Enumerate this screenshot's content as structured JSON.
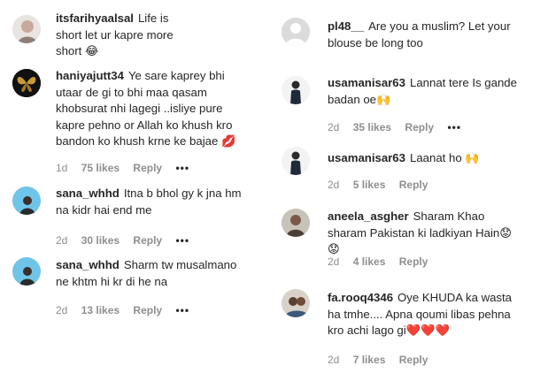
{
  "left": [
    {
      "user": "itsfarihyaalsal",
      "text": "Life is short let ur kapre more short 😂",
      "time": "",
      "likes": "",
      "reply": ""
    },
    {
      "user": "haniyajutt34",
      "text": "Ye sare kaprey bhi utaar de gi to bhi maa qasam khobsurat nhi lagegi ..isliye pure kapre pehno or Allah ko khush kro bandon ko khush krne ke bajae 💋",
      "time": "1d",
      "likes": "75 likes",
      "reply": "Reply",
      "more": "•••"
    },
    {
      "user": "sana_whhd",
      "text": "Itna b bhol gy k jna hm na kidr hai end me",
      "time": "2d",
      "likes": "30 likes",
      "reply": "Reply",
      "more": "•••"
    },
    {
      "user": "sana_whhd",
      "text": "Sharm tw musalmano ne khtm hi kr di he na",
      "time": "2d",
      "likes": "13 likes",
      "reply": "Reply",
      "more": "•••"
    }
  ],
  "right": [
    {
      "user": "pl48__",
      "text": "Are you a muslim? Let your blouse be long too",
      "time": "",
      "likes": "",
      "reply": ""
    },
    {
      "user": "usamanisar63",
      "text": "Lannat tere Is gande badan oe🙌",
      "time": "2d",
      "likes": "35 likes",
      "reply": "Reply",
      "more": "•••"
    },
    {
      "user": "usamanisar63",
      "text": "Laanat ho 🙌",
      "time": "2d",
      "likes": "5 likes",
      "reply": "Reply"
    },
    {
      "user": "aneela_asgher",
      "text": "Sharam Khao sharam Pakistan ki ladkiyan Hain😟😟",
      "time": "2d",
      "likes": "4 likes",
      "reply": "Reply"
    },
    {
      "user": "fa.rooq4346",
      "text": "Oye KHUDA ka wasta ha tmhe.... Apna qoumi libas pehna kro achi lago gi❤️❤️❤️",
      "time": "2d",
      "likes": "7 likes",
      "reply": "Reply"
    }
  ],
  "colors": {
    "text": "#262626",
    "meta": "#8e8e8e",
    "avatar_bg": "#dbdbdb"
  }
}
